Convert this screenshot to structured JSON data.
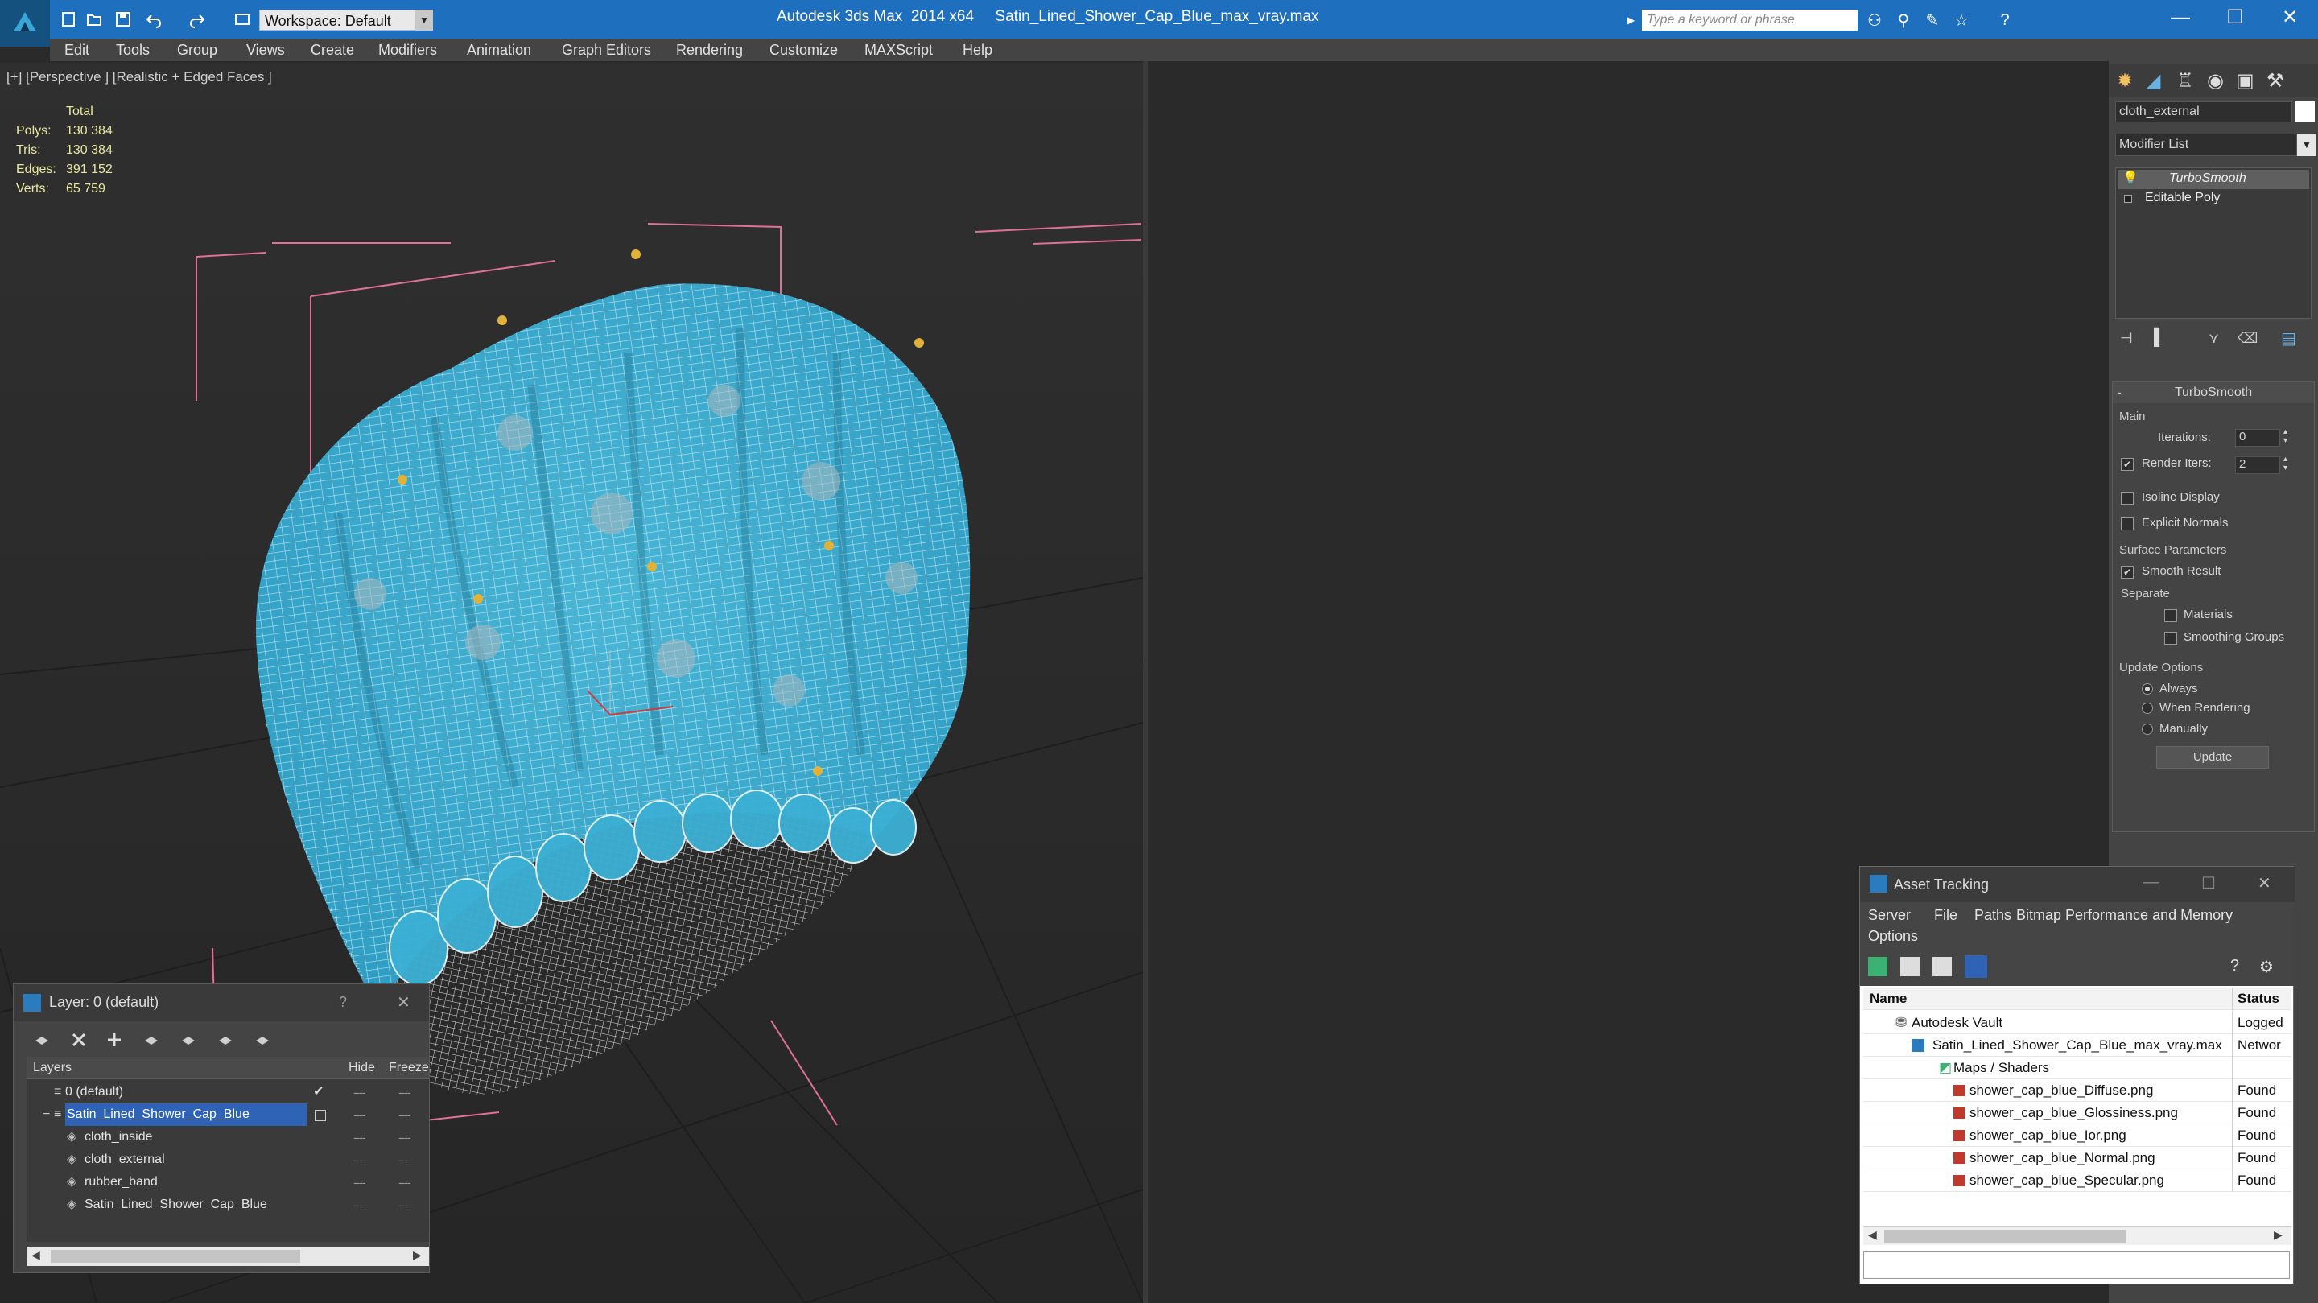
{
  "window": {
    "title": "Autodesk 3ds Max  2014 x64     Satin_Lined_Shower_Cap_Blue_max_vray.max",
    "workspace": "Workspace: Default",
    "search_placeholder": "Type a keyword or phrase"
  },
  "menu": [
    "Edit",
    "Tools",
    "Group",
    "Views",
    "Create",
    "Modifiers",
    "Animation",
    "Graph Editors",
    "Rendering",
    "Customize",
    "MAXScript",
    "Help"
  ],
  "viewport": {
    "label": "[+] [Perspective ] [Realistic + Edged Faces ]",
    "stats_header": "Total",
    "stats": [
      {
        "key": "Polys:",
        "value": "130 384"
      },
      {
        "key": "Tris:",
        "value": "130 384"
      },
      {
        "key": "Edges:",
        "value": "391 152"
      },
      {
        "key": "Verts:",
        "value": "65 759"
      }
    ]
  },
  "command_panel": {
    "object_name": "cloth_external",
    "modifier_list": "Modifier List",
    "stack": [
      "TurboSmooth",
      "Editable Poly"
    ],
    "rollout_title": "TurboSmooth",
    "main_label": "Main",
    "iterations_label": "Iterations:",
    "iterations_value": "0",
    "render_iters_label": "Render Iters:",
    "render_iters_value": "2",
    "isoline_label": "Isoline Display",
    "explicit_label": "Explicit Normals",
    "surface_label": "Surface Parameters",
    "smooth_result_label": "Smooth Result",
    "separate_label": "Separate",
    "materials_label": "Materials",
    "smoothing_groups_label": "Smoothing Groups",
    "update_options_label": "Update Options",
    "always_label": "Always",
    "when_rendering_label": "When Rendering",
    "manually_label": "Manually",
    "update_button": "Update"
  },
  "layer_window": {
    "title": "Layer: 0 (default)",
    "help": "?",
    "col_layers": "Layers",
    "col_hide": "Hide",
    "col_freeze": "Freeze",
    "rows": [
      {
        "name": "0 (default)",
        "indent": 0
      },
      {
        "name": "Satin_Lined_Shower_Cap_Blue",
        "indent": 0
      },
      {
        "name": "cloth_inside",
        "indent": 1
      },
      {
        "name": "cloth_external",
        "indent": 1
      },
      {
        "name": "rubber_band",
        "indent": 1
      },
      {
        "name": "Satin_Lined_Shower_Cap_Blue",
        "indent": 1
      }
    ]
  },
  "asset_tracking": {
    "title": "Asset Tracking",
    "menu": [
      "Server",
      "File",
      "Paths",
      "Bitmap Performance and Memory"
    ],
    "menu2": "Options",
    "col_name": "Name",
    "col_status": "Status",
    "rows": [
      {
        "name": "Autodesk Vault",
        "status": "Logged",
        "indent": 1
      },
      {
        "name": "Satin_Lined_Shower_Cap_Blue_max_vray.max",
        "status": "Networ",
        "indent": 2
      },
      {
        "name": "Maps / Shaders",
        "status": "",
        "indent": 3
      },
      {
        "name": "shower_cap_blue_Diffuse.png",
        "status": "Found",
        "indent": 4
      },
      {
        "name": "shower_cap_blue_Glossiness.png",
        "status": "Found",
        "indent": 4
      },
      {
        "name": "shower_cap_blue_Ior.png",
        "status": "Found",
        "indent": 4
      },
      {
        "name": "shower_cap_blue_Normal.png",
        "status": "Found",
        "indent": 4
      },
      {
        "name": "shower_cap_blue_Specular.png",
        "status": "Found",
        "indent": 4
      }
    ]
  }
}
